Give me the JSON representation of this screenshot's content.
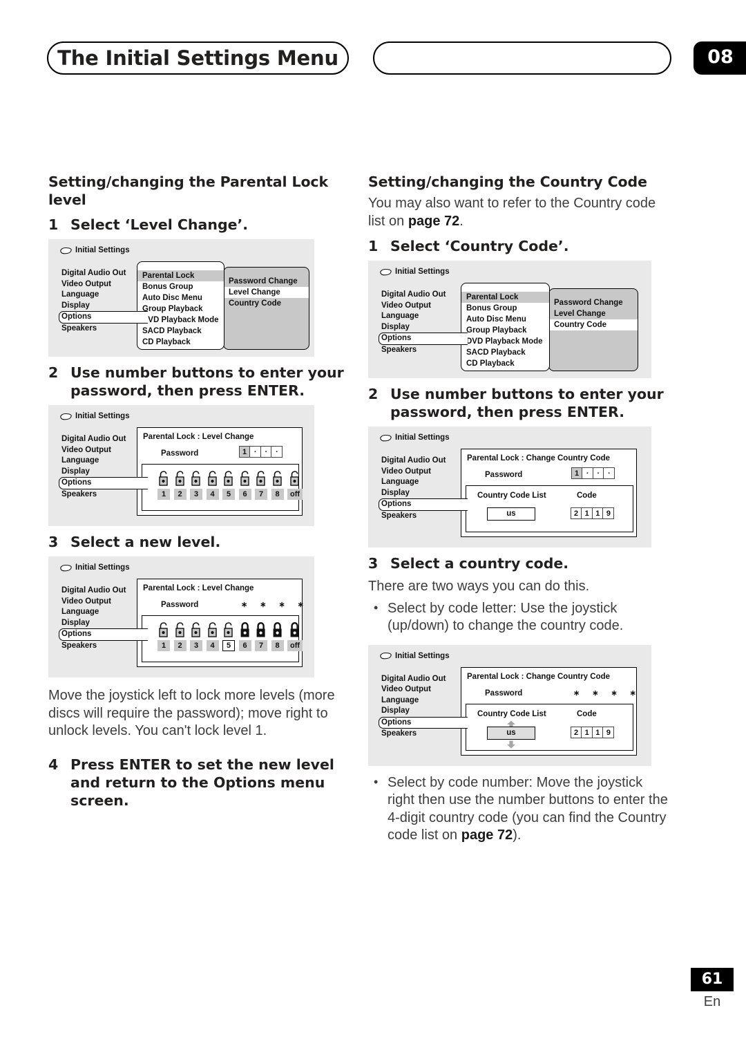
{
  "header": {
    "title": "The Initial Settings Menu",
    "chapter": "08",
    "blank_pill": ""
  },
  "footer": {
    "page_number": "61",
    "language": "En"
  },
  "left_column": {
    "heading": "Setting/changing the Parental Lock level",
    "step1": {
      "num": "1",
      "text": "Select ‘Level Change’."
    },
    "step2": {
      "num": "2",
      "text": "Use number buttons to enter your password, then press ENTER."
    },
    "step3": {
      "num": "3",
      "text": "Select a new level."
    },
    "note": "Move the joystick left to lock more levels (more discs will require the password); move right to unlock levels. You can't lock level 1.",
    "step4": {
      "num": "4",
      "text": "Press ENTER to set the new level and return to the Options menu screen."
    }
  },
  "right_column": {
    "heading": "Setting/changing the Country Code",
    "intro_a": "You may also want to refer to the Country code list on ",
    "intro_b": "page 72",
    "intro_c": ".",
    "step1": {
      "num": "1",
      "text": "Select ‘Country Code’."
    },
    "step2": {
      "num": "2",
      "text": "Use number buttons to enter your password, then press ENTER."
    },
    "step3": {
      "num": "3",
      "text": "Select a country code."
    },
    "step3_note": "There are two ways you can do this.",
    "bullet1": "Select by code letter: Use the joystick (up/down) to change the country code.",
    "bullet2_a": "Select by code number: Move the joystick right then use the number buttons to enter the 4-digit country code (you can find the Country code list on ",
    "bullet2_b": "page 72",
    "bullet2_c": ")."
  },
  "osd_common": {
    "title": "Initial Settings",
    "icon": "disc-icon",
    "left_menu": [
      "Digital Audio Out",
      "Video Output",
      "Language",
      "Display",
      "Options",
      "Speakers"
    ],
    "selected_left_item": "Options",
    "options_submenu": [
      "Parental Lock",
      "Bonus Group",
      "Auto Disc Menu",
      "Group Playback",
      "DVD Playback Mode",
      "SACD Playback",
      "CD Playback"
    ],
    "parental_lock_submenu": [
      "Password Change",
      "Level Change",
      "Country Code"
    ]
  },
  "osd1": {
    "highlighted_submenu_item": "Parental Lock",
    "highlighted_option": "Level Change"
  },
  "osd2": {
    "screen_title": "Parental Lock : Level Change",
    "password_label": "Password",
    "password_digits": [
      "1",
      "·",
      "·",
      "·"
    ],
    "active_digit_index": 0,
    "lock_labels": [
      "1",
      "2",
      "3",
      "4",
      "5",
      "6",
      "7",
      "8",
      "off"
    ],
    "lock_states": [
      "open",
      "open",
      "open",
      "open",
      "open",
      "open",
      "open",
      "open",
      "open"
    ],
    "selected_lock_index": -1
  },
  "osd3": {
    "screen_title": "Parental Lock : Level Change",
    "password_label": "Password",
    "password_masked": [
      "∗",
      "∗",
      "∗",
      "∗"
    ],
    "lock_labels": [
      "1",
      "2",
      "3",
      "4",
      "5",
      "6",
      "7",
      "8",
      "off"
    ],
    "lock_states": [
      "open",
      "open",
      "open",
      "open",
      "open",
      "closed",
      "closed",
      "closed",
      "closed"
    ],
    "selected_lock_index": 4
  },
  "osd4": {
    "highlighted_submenu_item": "Parental Lock",
    "highlighted_option": "Country Code"
  },
  "osd5": {
    "screen_title": "Parental Lock : Change Country Code",
    "password_label": "Password",
    "password_digits": [
      "1",
      "·",
      "·",
      "·"
    ],
    "active_digit_index": 0,
    "country_code_list_label": "Country Code List",
    "code_label": "Code",
    "country_value": "us",
    "code_digits": [
      "2",
      "1",
      "1",
      "9"
    ],
    "show_arrows": false
  },
  "osd6": {
    "screen_title": "Parental Lock : Change Country Code",
    "password_label": "Password",
    "password_masked": [
      "∗",
      "∗",
      "∗",
      "∗"
    ],
    "country_code_list_label": "Country Code List",
    "code_label": "Code",
    "country_value": "us",
    "code_digits": [
      "2",
      "1",
      "1",
      "9"
    ],
    "show_arrows": true
  },
  "colors": {
    "osd_background": "#e9e9e9",
    "menu_highlight_gray": "#c8c8c8",
    "menu_highlight_white": "#ffffff",
    "text": "#221f1f",
    "body_text": "#3d3d3d",
    "accent_black": "#000000"
  }
}
